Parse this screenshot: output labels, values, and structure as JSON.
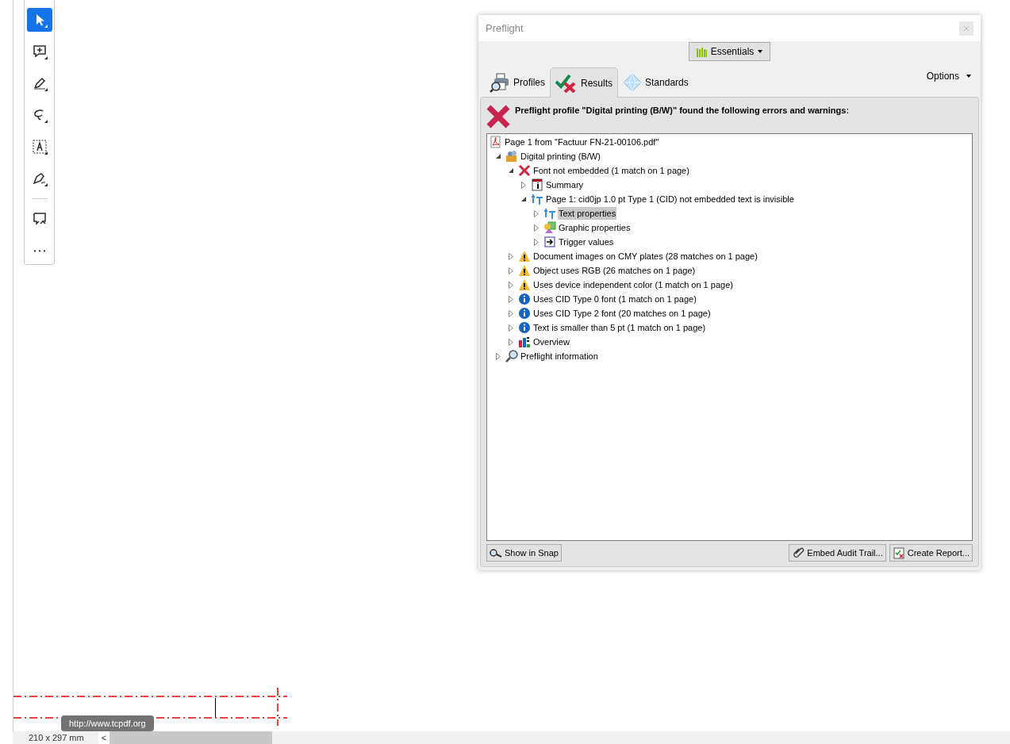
{
  "toolbar": {
    "tools": [
      {
        "kind": "select",
        "selected": true
      },
      {
        "kind": "comment",
        "selected": false
      },
      {
        "kind": "highlight",
        "selected": false
      },
      {
        "kind": "lasso",
        "selected": false
      },
      {
        "kind": "textbox",
        "selected": false
      },
      {
        "kind": "sign",
        "selected": false
      },
      {
        "kind": "share",
        "selected": false
      },
      {
        "kind": "more",
        "selected": false
      }
    ]
  },
  "preflight": {
    "title": "Preflight",
    "workspace": "Essentials",
    "tabs": [
      {
        "label": "Profiles",
        "kind": "profiles",
        "selected": false
      },
      {
        "label": "Results",
        "kind": "results",
        "selected": true
      },
      {
        "label": "Standards",
        "kind": "standards",
        "selected": false
      }
    ],
    "options": "Options",
    "message": "Preflight profile \"Digital printing (B/W)\" found the following errors and warnings:",
    "tree": [
      {
        "label": "Page 1 from \"Factuur FN-21-00106.pdf\"",
        "kind": "pdf",
        "selected": false,
        "children": [
          {
            "label": "Digital printing (B/W)",
            "kind": "profile",
            "expanded": true,
            "selected": false,
            "children": [
              {
                "label": "Font not embedded (1 match on 1 page)",
                "kind": "error",
                "expanded": true,
                "selected": false,
                "children": [
                  {
                    "label": "Summary",
                    "kind": "summary",
                    "expanded": false,
                    "selected": false
                  },
                  {
                    "label": "Page 1: cid0jp 1.0 pt Type 1 (CID) not embedded text is invisible",
                    "kind": "text",
                    "expanded": true,
                    "selected": false,
                    "children": [
                      {
                        "label": "Text properties",
                        "kind": "text",
                        "expanded": false,
                        "selected": true
                      },
                      {
                        "label": "Graphic properties",
                        "kind": "graphic",
                        "expanded": false,
                        "selected": false
                      },
                      {
                        "label": "Trigger values",
                        "kind": "trigger",
                        "expanded": false,
                        "selected": false
                      }
                    ]
                  }
                ]
              },
              {
                "label": "Document images on CMY plates (28 matches on 1 page)",
                "kind": "warning",
                "expanded": false,
                "selected": false
              },
              {
                "label": "Object uses RGB (26 matches on 1 page)",
                "kind": "warning",
                "expanded": false,
                "selected": false
              },
              {
                "label": "Uses device independent color (1 match on 1 page)",
                "kind": "warning",
                "expanded": false,
                "selected": false
              },
              {
                "label": "Uses CID Type 0 font (1 match on 1 page)",
                "kind": "info",
                "expanded": false,
                "selected": false
              },
              {
                "label": "Uses CID Type 2 font (20 matches on 1 page)",
                "kind": "info",
                "expanded": false,
                "selected": false
              },
              {
                "label": "Text is smaller than 5 pt (1 match on 1 page)",
                "kind": "info",
                "expanded": false,
                "selected": false
              },
              {
                "label": "Overview",
                "kind": "overview",
                "expanded": false,
                "selected": false
              }
            ]
          },
          {
            "label": "Preflight information",
            "kind": "search",
            "expanded": false,
            "selected": false
          }
        ]
      }
    ],
    "buttons": [
      {
        "label": "Show in Snap",
        "kind": "snap"
      },
      {
        "label": "Embed Audit Trail...",
        "kind": "clip"
      },
      {
        "label": "Create Report...",
        "kind": "report"
      }
    ]
  },
  "tooltip": "http://www.tcpdf.org",
  "status_bar": {
    "page_size": "210 x 297 mm",
    "scroll_left": "<"
  }
}
